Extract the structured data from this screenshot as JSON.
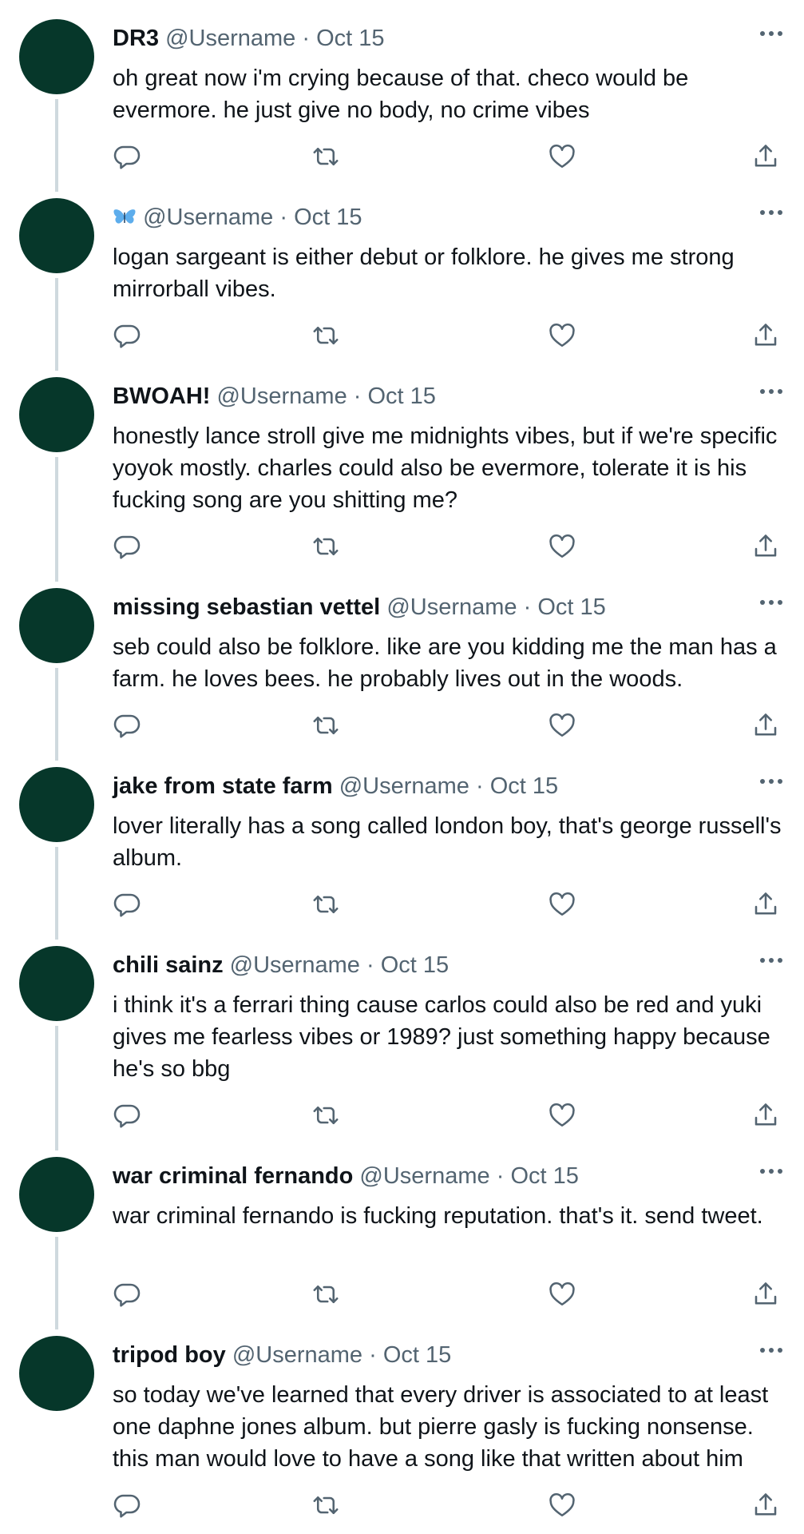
{
  "colors": {
    "avatar": "#06372a",
    "thread_line": "#cfd9de",
    "muted": "#536471",
    "text": "#0f1419"
  },
  "tweets": [
    {
      "name": "DR3",
      "name_icon": "",
      "handle": "@Username",
      "sep": "·",
      "date": "Oct 15",
      "text": "oh great now i'm crying because of that. checo would be evermore. he just give no body, no crime vibes"
    },
    {
      "name": "",
      "name_icon": "butterfly-icon",
      "handle": "@Username",
      "sep": "·",
      "date": "Oct 15",
      "text": "logan sargeant is either debut or folklore. he gives me strong mirrorball vibes."
    },
    {
      "name": "BWOAH!",
      "name_icon": "",
      "handle": "@Username",
      "sep": "·",
      "date": "Oct 15",
      "text": "honestly lance stroll give me midnights vibes, but if we're specific yoyok mostly. charles could also be evermore, tolerate it is his fucking song are you shitting me?"
    },
    {
      "name": "missing sebastian vettel",
      "name_icon": "",
      "handle": "@Username",
      "sep": "·",
      "date": "Oct 15",
      "text": "seb could also be folklore. like are you kidding me the man has a farm. he loves bees. he probably lives out in the woods."
    },
    {
      "name": "jake from state farm",
      "name_icon": "",
      "handle": "@Username",
      "sep": "·",
      "date": "Oct 15",
      "text": "lover literally has a song called london boy, that's george russell's album."
    },
    {
      "name": "chili sainz",
      "name_icon": "",
      "handle": "@Username",
      "sep": "·",
      "date": "Oct 15",
      "text": "i think it's a ferrari thing cause carlos could also be red and yuki gives me fearless vibes or 1989? just something happy because he's so bbg"
    },
    {
      "name": "war criminal fernando",
      "name_icon": "",
      "handle": "@Username",
      "sep": "·",
      "date": "Oct 15",
      "text": "war criminal fernando is fucking reputation. that's it. send tweet."
    },
    {
      "name": "tripod boy",
      "name_icon": "",
      "handle": "@Username",
      "sep": "·",
      "date": "Oct 15",
      "text": "so today we've learned that every driver is associated to at least one daphne jones album. but pierre gasly is fucking nonsense. this man would love to have a song like that written about him"
    }
  ]
}
